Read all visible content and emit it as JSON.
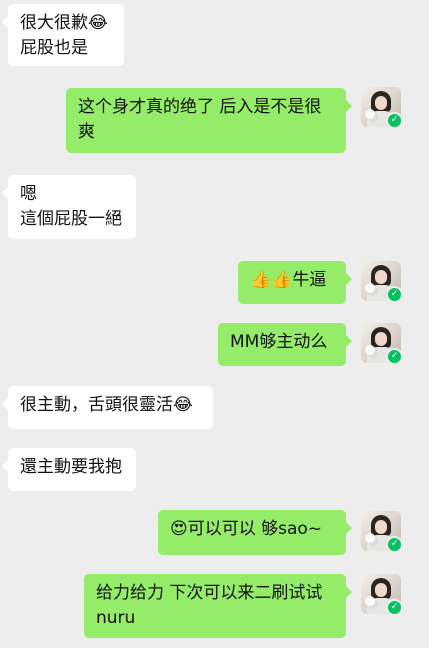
{
  "messages": [
    {
      "side": "left",
      "text": "很大很歉😂\n屁股也是"
    },
    {
      "side": "right",
      "text": "这个身才真的绝了  后入是不是很爽"
    },
    {
      "side": "left",
      "text": "嗯\n這個屁股一絕"
    },
    {
      "side": "right",
      "text": "👍👍牛逼"
    },
    {
      "side": "right",
      "text": "MM够主动么"
    },
    {
      "side": "left",
      "text": "很主動，舌頭很靈活😂"
    },
    {
      "side": "left",
      "text": "還主動要我抱"
    },
    {
      "side": "right",
      "text": "😍可以可以  够sao~"
    },
    {
      "side": "right",
      "text": "给力给力  下次可以来二刷试试nuru"
    }
  ],
  "icons": {
    "verified_badge": "check-icon",
    "verified_glyph": "✓",
    "verified_color": "#07c160"
  },
  "colors": {
    "background": "#ededed",
    "left_bubble": "#ffffff",
    "right_bubble": "#95ec69"
  }
}
